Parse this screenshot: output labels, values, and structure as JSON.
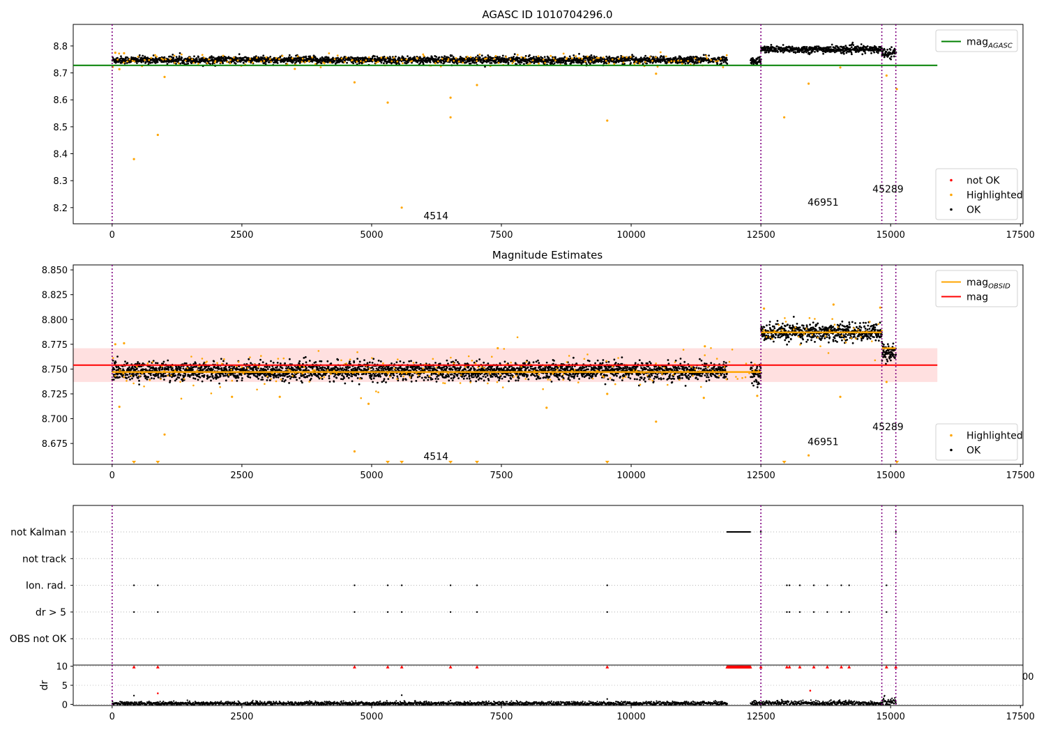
{
  "colors": {
    "ok": "#000000",
    "highlighted": "#ffa500",
    "not_ok": "#ff0000",
    "mag_agasc_line": "#008000",
    "mag_obsid_line": "#ffa500",
    "mag_line": "#ff0000",
    "mag_band": "#ffcccc",
    "obs_boundary": "#800080",
    "grid": "#b0b0b0"
  },
  "chart_data": [
    {
      "type": "scatter",
      "title": "AGASC ID 1010704296.0",
      "xlabel": "",
      "ylabel": "",
      "xlim": [
        -750,
        17550
      ],
      "ylim": [
        8.14,
        8.88
      ],
      "x_ticks": [
        0,
        2500,
        5000,
        7500,
        10000,
        12500,
        15000,
        17500
      ],
      "x_tick_labels": [
        "0",
        "2500",
        "5000",
        "7500",
        "10000",
        "12500",
        "15000",
        "17500"
      ],
      "y_ticks": [
        8.2,
        8.3,
        8.4,
        8.5,
        8.6,
        8.7,
        8.8
      ],
      "y_tick_labels": [
        "8.2",
        "8.3",
        "8.4",
        "8.5",
        "8.6",
        "8.7",
        "8.8"
      ],
      "legends": [
        {
          "placement": "upper right",
          "entries": [
            {
              "label": "mag",
              "sub": "AGASC",
              "kind": "line",
              "color": "#008000"
            }
          ]
        },
        {
          "placement": "lower right",
          "entries": [
            {
              "label": "not OK",
              "kind": "dot",
              "color": "#ff0000"
            },
            {
              "label": "Highlighted",
              "kind": "dot",
              "color": "#ffa500"
            },
            {
              "label": "OK",
              "kind": "dot",
              "color": "#000000"
            }
          ]
        }
      ],
      "observation_boundaries": [
        0,
        12500,
        14830,
        15100
      ],
      "obsid_labels": [
        {
          "text": "4514",
          "x": 6000,
          "y": 8.17
        },
        {
          "text": "46951",
          "x": 13400,
          "y": 8.22
        },
        {
          "text": "45289",
          "x": 14650,
          "y": 8.27
        }
      ],
      "reference_lines": [
        {
          "name": "mag_AGASC",
          "y": 8.728,
          "x_range": [
            -750,
            15900
          ],
          "color": "#008000"
        }
      ],
      "series": [
        {
          "name": "OK",
          "segments": [
            {
              "x_range": [
                0,
                11850
              ],
              "center": 8.748,
              "spread": 0.012
            },
            {
              "x_range": [
                12300,
                12500
              ],
              "center": 8.745,
              "spread": 0.012
            },
            {
              "x_range": [
                12500,
                14830
              ],
              "center": 8.787,
              "spread": 0.012
            },
            {
              "x_range": [
                14830,
                15100
              ],
              "center": 8.775,
              "spread": 0.015
            }
          ]
        },
        {
          "name": "Highlighted",
          "points": [
            [
              420,
              8.38
            ],
            [
              880,
              8.47
            ],
            [
              1010,
              8.685
            ],
            [
              4670,
              8.665
            ],
            [
              5310,
              8.59
            ],
            [
              5580,
              8.2
            ],
            [
              6520,
              8.535
            ],
            [
              6520,
              8.608
            ],
            [
              7030,
              8.655
            ],
            [
              9540,
              8.523
            ],
            [
              10480,
              8.697
            ],
            [
              12950,
              8.535
            ],
            [
              13420,
              8.66
            ],
            [
              14030,
              8.72
            ],
            [
              14920,
              8.69
            ],
            [
              15120,
              8.64
            ],
            [
              140,
              8.714
            ],
            [
              60,
              8.775
            ],
            [
              230,
              8.773
            ],
            [
              3520,
              8.715
            ]
          ]
        }
      ]
    },
    {
      "type": "scatter",
      "title": "Magnitude Estimates",
      "xlabel": "",
      "ylabel": "",
      "xlim": [
        -750,
        17550
      ],
      "ylim": [
        8.654,
        8.855
      ],
      "x_ticks": [
        0,
        2500,
        5000,
        7500,
        10000,
        12500,
        15000,
        17500
      ],
      "x_tick_labels": [
        "0",
        "2500",
        "5000",
        "7500",
        "10000",
        "12500",
        "15000",
        "17500"
      ],
      "y_ticks": [
        8.675,
        8.7,
        8.725,
        8.75,
        8.775,
        8.8,
        8.825,
        8.85
      ],
      "y_tick_labels": [
        "8.675",
        "8.700",
        "8.725",
        "8.750",
        "8.775",
        "8.800",
        "8.825",
        "8.850"
      ],
      "legends": [
        {
          "placement": "upper right",
          "entries": [
            {
              "label": "mag",
              "sub": "OBSID",
              "kind": "line",
              "color": "#ffa500"
            },
            {
              "label": "mag",
              "kind": "line",
              "color": "#ff0000"
            }
          ]
        },
        {
          "placement": "lower right",
          "entries": [
            {
              "label": "Highlighted",
              "kind": "dot",
              "color": "#ffa500"
            },
            {
              "label": "OK",
              "kind": "dot",
              "color": "#000000"
            }
          ]
        }
      ],
      "observation_boundaries": [
        0,
        12500,
        14830,
        15100
      ],
      "obsid_labels": [
        {
          "text": "4514",
          "x": 6000,
          "y": 8.662
        },
        {
          "text": "46951",
          "x": 13400,
          "y": 8.677
        },
        {
          "text": "45289",
          "x": 14650,
          "y": 8.692
        }
      ],
      "mag_band": {
        "y_range": [
          8.737,
          8.771
        ],
        "x_range": [
          -750,
          15900
        ]
      },
      "reference_lines": [
        {
          "name": "mag",
          "y": 8.754,
          "x_range": [
            -750,
            15900
          ],
          "color": "#ff0000"
        }
      ],
      "mag_obsid_segments": [
        {
          "x_range": [
            0,
            11850
          ],
          "y": 8.747
        },
        {
          "x_range": [
            11850,
            12500
          ],
          "y": 8.747
        },
        {
          "x_range": [
            12500,
            14830
          ],
          "y": 8.787
        },
        {
          "x_range": [
            14830,
            15100
          ],
          "y": 8.771
        }
      ],
      "series": [
        {
          "name": "OK",
          "segments": [
            {
              "x_range": [
                0,
                11850
              ],
              "center": 8.748,
              "spread": 0.008
            },
            {
              "x_range": [
                12300,
                12500
              ],
              "center": 8.745,
              "spread": 0.008
            },
            {
              "x_range": [
                12500,
                14830
              ],
              "center": 8.787,
              "spread": 0.008
            },
            {
              "x_range": [
                14830,
                15100
              ],
              "center": 8.766,
              "spread": 0.01
            }
          ]
        },
        {
          "name": "Highlighted",
          "points": [
            [
              140,
              8.712
            ],
            [
              1010,
              8.684
            ],
            [
              4670,
              8.667
            ],
            [
              10480,
              8.697
            ],
            [
              14030,
              8.722
            ],
            [
              14920,
              8.737
            ],
            [
              13420,
              8.663
            ],
            [
              2310,
              8.722
            ],
            [
              3230,
              8.722
            ],
            [
              4940,
              8.715
            ],
            [
              8370,
              8.711
            ],
            [
              9540,
              8.725
            ],
            [
              11400,
              8.721
            ],
            [
              12430,
              8.723
            ],
            [
              14800,
              8.812
            ],
            [
              13900,
              8.815
            ],
            [
              12560,
              8.811
            ],
            [
              60,
              8.775
            ],
            [
              230,
              8.776
            ],
            [
              7430,
              8.771
            ],
            [
              11420,
              8.773
            ]
          ]
        },
        {
          "name": "Highlighted (below axis)",
          "points": [
            [
              420,
              8.654
            ],
            [
              880,
              8.654
            ],
            [
              5310,
              8.654
            ],
            [
              5580,
              8.654
            ],
            [
              6520,
              8.654
            ],
            [
              7030,
              8.654
            ],
            [
              9540,
              8.654
            ],
            [
              12950,
              8.654
            ],
            [
              15120,
              8.654
            ]
          ]
        }
      ]
    },
    {
      "type": "scatter",
      "title": "",
      "xlabel": "",
      "ylabel": "",
      "xlim": [
        -750,
        17550
      ],
      "categories": [
        "not Kalman",
        "not track",
        "Ion. rad.",
        "dr > 5",
        "OBS not OK"
      ],
      "flag_rows": [
        {
          "label": "not Kalman",
          "x_ranges": [
            [
              11850,
              12300
            ]
          ],
          "x": [
            12500,
            15100
          ]
        },
        {
          "label": "not track",
          "x": []
        },
        {
          "label": "Ion. rad.",
          "x": [
            420,
            880,
            4670,
            5310,
            5580,
            6520,
            7030,
            9540,
            13000,
            13050,
            13250,
            13520,
            13780,
            14050,
            14200,
            14920
          ]
        },
        {
          "label": "dr > 5",
          "x": [
            420,
            880,
            4670,
            5310,
            5580,
            6520,
            7030,
            9540,
            13000,
            13050,
            13250,
            13520,
            13780,
            14050,
            14200,
            14920
          ]
        },
        {
          "label": "OBS not OK",
          "x": []
        }
      ],
      "observation_boundaries": [
        0,
        12500,
        14830,
        15100
      ]
    },
    {
      "type": "scatter",
      "title": "",
      "xlabel": "",
      "ylabel": "dr",
      "xlim": [
        -750,
        17550
      ],
      "ylim": [
        -0.3,
        10.3
      ],
      "x_ticks": [
        0,
        2500,
        5000,
        7500,
        10000,
        12500,
        15000,
        17500
      ],
      "x_tick_labels": [
        "0",
        "2500",
        "5000",
        "7500",
        "10000",
        "12500",
        "15000",
        "17500"
      ],
      "y_ticks": [
        0,
        5,
        10
      ],
      "y_tick_labels": [
        "0",
        "5",
        "10"
      ],
      "clipped_tick_label": "00",
      "observation_boundaries": [
        0,
        12500,
        14830,
        15100
      ],
      "series": [
        {
          "name": "OK",
          "segments": [
            {
              "x_range": [
                0,
                11850
              ],
              "center": 0.25,
              "spread": 0.25
            },
            {
              "x_range": [
                12300,
                14830
              ],
              "center": 0.35,
              "spread": 0.3
            },
            {
              "x_range": [
                14830,
                15100
              ],
              "center": 0.8,
              "spread": 0.6
            }
          ],
          "extra_points": [
            [
              420,
              2.3
            ],
            [
              5580,
              2.4
            ],
            [
              9540,
              1.4
            ],
            [
              6520,
              1.0
            ],
            [
              12900,
              1.2
            ],
            [
              13850,
              1.1
            ]
          ]
        },
        {
          "name": "not OK",
          "points": [
            [
              420,
              9.8
            ],
            [
              880,
              9.8
            ],
            [
              4670,
              9.8
            ],
            [
              5310,
              9.8
            ],
            [
              5580,
              9.8
            ],
            [
              6520,
              9.8
            ],
            [
              7030,
              9.8
            ],
            [
              9540,
              9.8
            ],
            [
              12500,
              9.8
            ],
            [
              13000,
              9.8
            ],
            [
              13050,
              9.8
            ],
            [
              13250,
              9.8
            ],
            [
              13520,
              9.8
            ],
            [
              13780,
              9.8
            ],
            [
              14050,
              9.8
            ],
            [
              14200,
              9.8
            ],
            [
              14920,
              9.8
            ],
            [
              15100,
              9.8
            ],
            [
              880,
              2.9
            ],
            [
              13450,
              3.6
            ]
          ],
          "x_ranges_at_top": [
            [
              11850,
              12300
            ]
          ]
        }
      ]
    }
  ]
}
